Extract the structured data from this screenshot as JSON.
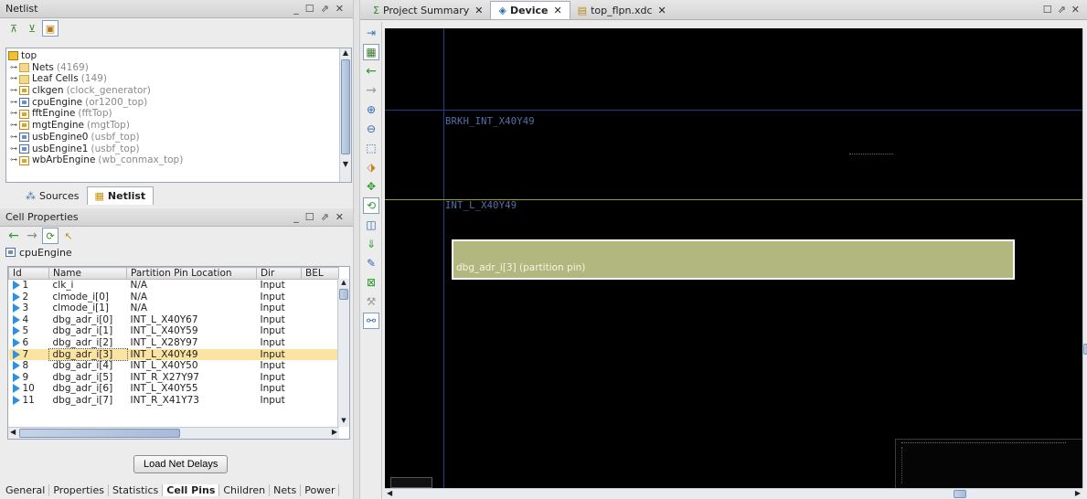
{
  "netlist": {
    "title": "Netlist",
    "tree": {
      "root": "top",
      "items": [
        {
          "name": "Nets",
          "extra": "(4169)",
          "icon": "folder-icon"
        },
        {
          "name": "Leaf Cells",
          "extra": "(149)",
          "icon": "folder-icon"
        },
        {
          "name": "clkgen",
          "extra": "(clock_generator)",
          "icon": "cell-icon"
        },
        {
          "name": "cpuEngine",
          "extra": "(or1200_top)",
          "icon": "cell-blue-icon"
        },
        {
          "name": "fftEngine",
          "extra": "(fftTop)",
          "icon": "cell-icon"
        },
        {
          "name": "mgtEngine",
          "extra": "(mgtTop)",
          "icon": "cell-icon"
        },
        {
          "name": "usbEngine0",
          "extra": "(usbf_top)",
          "icon": "cell-blue-icon"
        },
        {
          "name": "usbEngine1",
          "extra": "(usbf_top)",
          "icon": "cell-blue-icon"
        },
        {
          "name": "wbArbEngine",
          "extra": "(wb_conmax_top)",
          "icon": "cell-icon"
        }
      ]
    },
    "tabs": {
      "sources": "Sources",
      "netlist": "Netlist"
    }
  },
  "cell_properties": {
    "title": "Cell Properties",
    "cell_name": "cpuEngine",
    "columns": {
      "id": "Id",
      "name": "Name",
      "ppl": "Partition Pin Location",
      "dir": "Dir",
      "bel": "BEL"
    },
    "rows": [
      {
        "id": "1",
        "name": "clk_i",
        "loc": "N/A",
        "dir": "Input"
      },
      {
        "id": "2",
        "name": "clmode_i[0]",
        "loc": "N/A",
        "dir": "Input"
      },
      {
        "id": "3",
        "name": "clmode_i[1]",
        "loc": "N/A",
        "dir": "Input"
      },
      {
        "id": "4",
        "name": "dbg_adr_i[0]",
        "loc": "INT_L_X40Y67",
        "dir": "Input"
      },
      {
        "id": "5",
        "name": "dbg_adr_i[1]",
        "loc": "INT_L_X40Y59",
        "dir": "Input"
      },
      {
        "id": "6",
        "name": "dbg_adr_i[2]",
        "loc": "INT_L_X28Y97",
        "dir": "Input"
      },
      {
        "id": "7",
        "name": "dbg_adr_i[3]",
        "loc": "INT_L_X40Y49",
        "dir": "Input"
      },
      {
        "id": "8",
        "name": "dbg_adr_i[4]",
        "loc": "INT_L_X40Y50",
        "dir": "Input"
      },
      {
        "id": "9",
        "name": "dbg_adr_i[5]",
        "loc": "INT_R_X27Y97",
        "dir": "Input"
      },
      {
        "id": "10",
        "name": "dbg_adr_i[6]",
        "loc": "INT_L_X40Y55",
        "dir": "Input"
      },
      {
        "id": "11",
        "name": "dbg_adr_i[7]",
        "loc": "INT_R_X41Y73",
        "dir": "Input"
      }
    ],
    "selected_row": 6,
    "load_button": "Load Net Delays",
    "bottom_tabs": [
      "General",
      "Properties",
      "Statistics",
      "Cell Pins",
      "Children",
      "Nets",
      "Power"
    ],
    "active_bottom_tab": "Cell Pins"
  },
  "editor_tabs": [
    {
      "label": "Project Summary",
      "icon": "sigma-icon"
    },
    {
      "label": "Device",
      "icon": "device-icon"
    },
    {
      "label": "top_flpn.xdc",
      "icon": "file-icon"
    }
  ],
  "device": {
    "label_brkh": "BRKH_INT_X40Y49",
    "label_int": "INT_L_X40Y49",
    "pin_label": "dbg_adr_i[3] (partition pin)",
    "colors": {
      "background": "#000000",
      "pin_fill": "#b1b77f",
      "pin_border": "#ffffff",
      "grid_blue": "#1f3f88",
      "grid_yellow": "#9a9a1e"
    }
  }
}
